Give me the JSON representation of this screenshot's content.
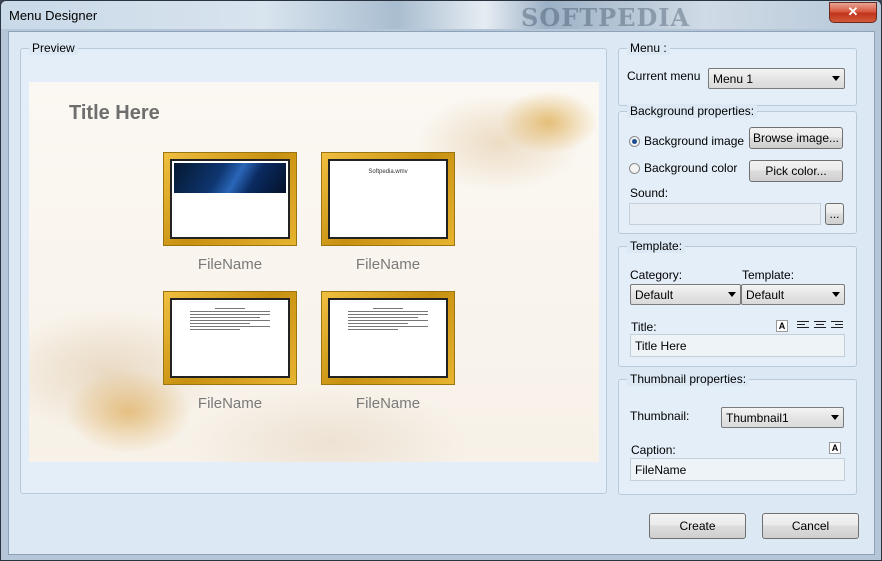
{
  "window": {
    "title": "Menu Designer",
    "watermark": "SOFTPEDIA",
    "close_glyph": "✕"
  },
  "preview": {
    "legend": "Preview",
    "title_text": "Title Here",
    "thumbnails": [
      {
        "caption": "FileName",
        "content": "image"
      },
      {
        "caption": "FileName",
        "content": "text",
        "heading": "Softpedia.wmv"
      },
      {
        "caption": "FileName",
        "content": "document"
      },
      {
        "caption": "FileName",
        "content": "document"
      }
    ]
  },
  "menu": {
    "legend": "Menu :",
    "current_menu_label": "Current menu",
    "current_menu_value": "Menu 1"
  },
  "background": {
    "legend": "Background properties:",
    "image_option": "Background image",
    "image_selected": true,
    "color_option": "Background color",
    "browse_button": "Browse image...",
    "pick_color_button": "Pick color...",
    "sound_label": "Sound:",
    "sound_value": "",
    "sound_browse": "..."
  },
  "template": {
    "legend": "Template:",
    "category_label": "Category:",
    "category_value": "Default",
    "template_label": "Template:",
    "template_value": "Default",
    "title_label": "Title:",
    "title_value": "Title Here",
    "font_glyph": "A"
  },
  "thumbnail_props": {
    "legend": "Thumbnail properties:",
    "thumbnail_label": "Thumbnail:",
    "thumbnail_value": "Thumbnail1",
    "caption_label": "Caption:",
    "caption_value": "FileName",
    "font_glyph": "A"
  },
  "actions": {
    "create": "Create",
    "cancel": "Cancel"
  }
}
